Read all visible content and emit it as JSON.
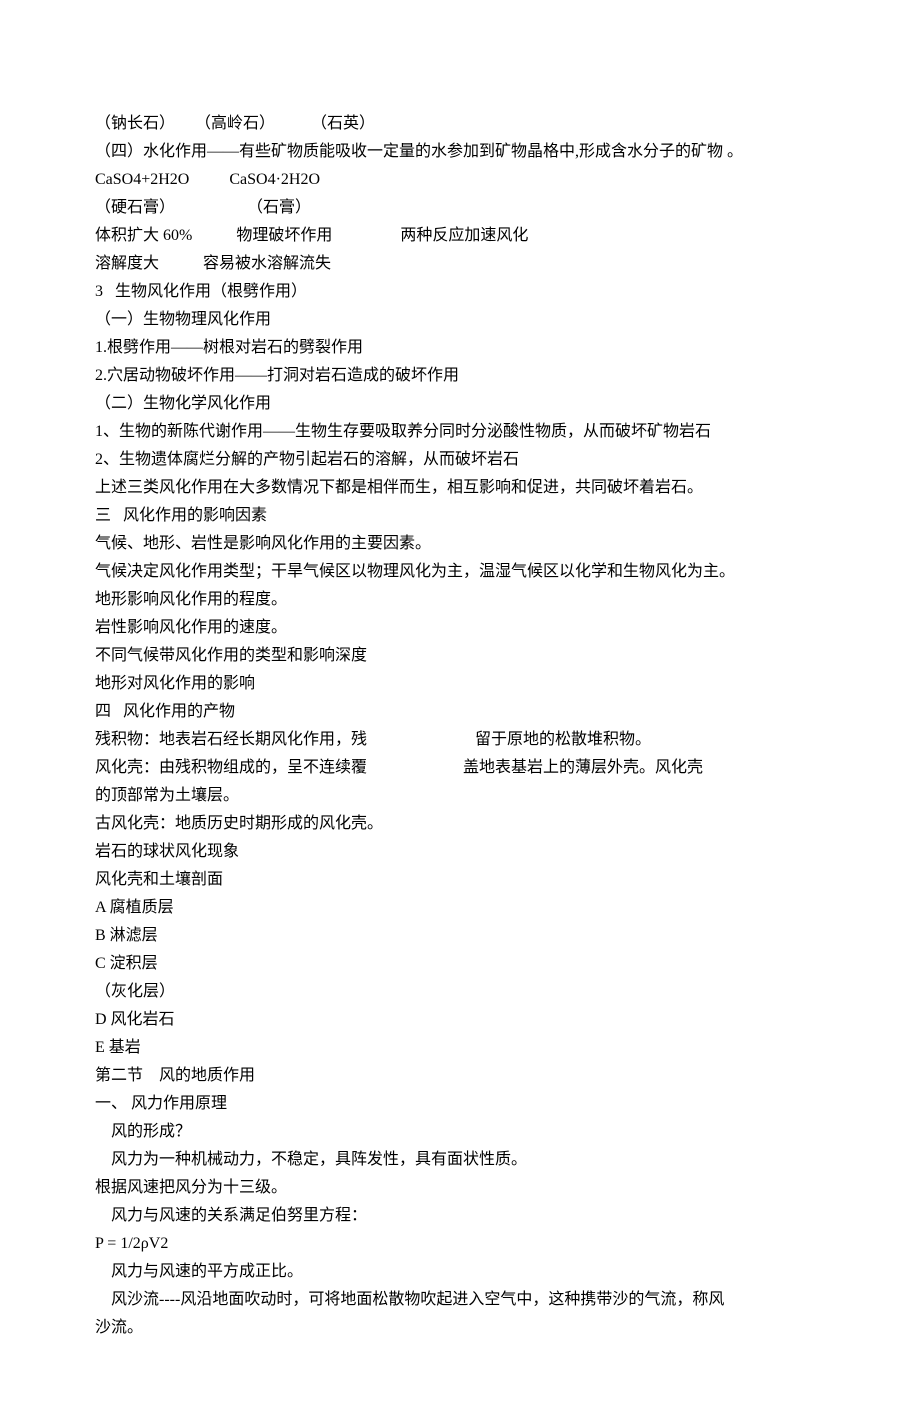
{
  "lines": [
    "（钠长石）     （高岭石）         （石英）",
    "（四）水化作用——有些矿物质能吸收一定量的水参加到矿物晶格中,形成含水分子的矿物 。",
    "CaSO4+2H2O          CaSO4·2H2O",
    "（硬石膏）                  （石膏）",
    "体积扩大 60%           物理破坏作用                 两种反应加速风化",
    "溶解度大           容易被水溶解流失",
    "3   生物风化作用（根劈作用）",
    "（一）生物物理风化作用",
    "1.根劈作用——树根对岩石的劈裂作用",
    "2.穴居动物破坏作用——打洞对岩石造成的破坏作用",
    "（二）生物化学风化作用",
    "1、生物的新陈代谢作用——生物生存要吸取养分同时分泌酸性物质，从而破坏矿物岩石",
    "2、生物遗体腐烂分解的产物引起岩石的溶解，从而破坏岩石",
    "上述三类风化作用在大多数情况下都是相伴而生，相互影响和促进，共同破坏着岩石。",
    "三   风化作用的影响因素",
    "气候、地形、岩性是影响风化作用的主要因素。",
    "气候决定风化作用类型；干旱气候区以物理风化为主，温湿气候区以化学和生物风化为主。",
    "地形影响风化作用的程度。",
    "岩性影响风化作用的速度。",
    "不同气候带风化作用的类型和影响深度",
    "地形对风化作用的影响",
    "四   风化作用的产物",
    "残积物：地表岩石经长期风化作用，残                           留于原地的松散堆积物。",
    "风化壳：由残积物组成的，呈不连续覆                        盖地表基岩上的薄层外壳。风化壳",
    "的顶部常为土壤层。",
    "古风化壳：地质历史时期形成的风化壳。",
    "岩石的球状风化现象",
    "风化壳和土壤剖面",
    "A 腐植质层",
    "B 淋滤层",
    "C 淀积层",
    "（灰化层）",
    "D 风化岩石",
    "E 基岩",
    "第二节    风的地质作用",
    "一、 风力作用原理",
    "    风的形成？",
    "    风力为一种机械动力，不稳定，具阵发性，具有面状性质。",
    "根据风速把风分为十三级。",
    "    风力与风速的关系满足伯努里方程：",
    "P = 1/2ρV2",
    "    风力与风速的平方成正比。",
    "    风沙流----风沿地面吹动时，可将地面松散物吹起进入空气中，这种携带沙的气流，称风",
    "沙流。"
  ]
}
